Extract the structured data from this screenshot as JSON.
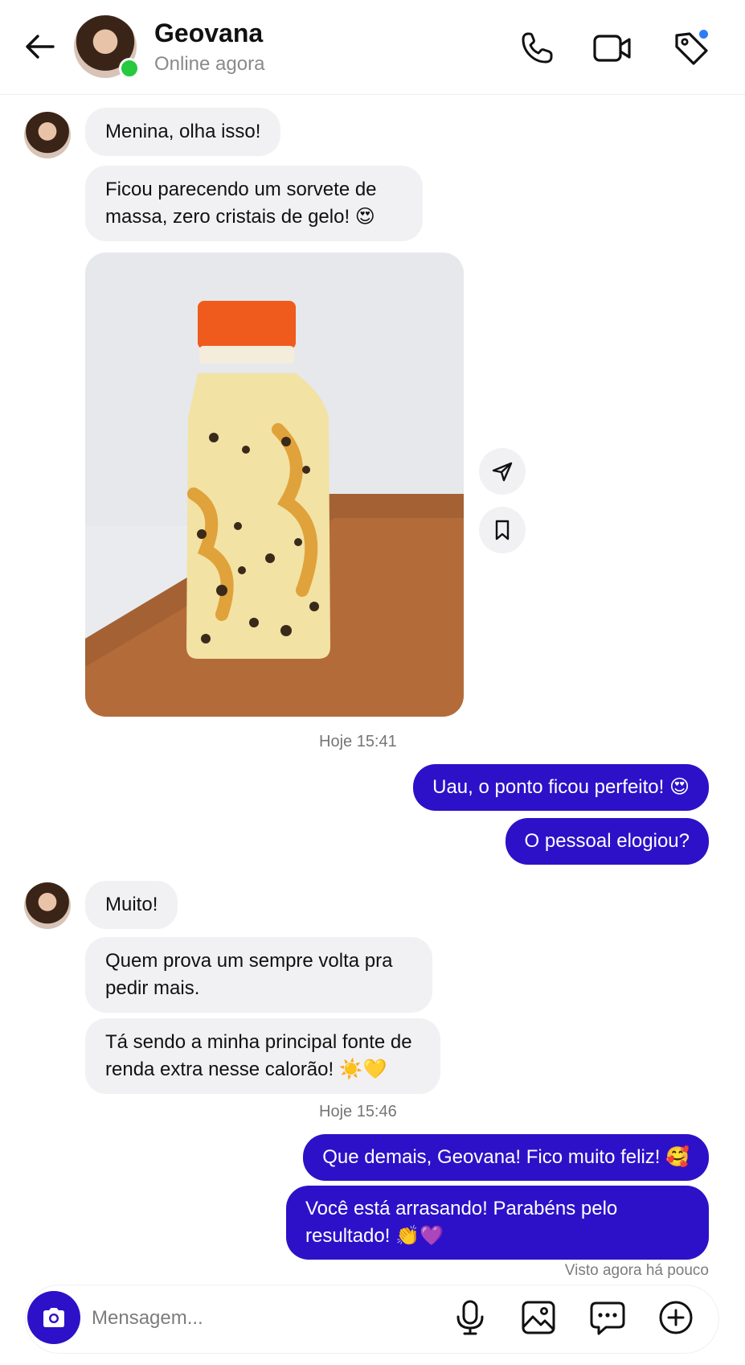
{
  "header": {
    "contact_name": "Geovana",
    "status": "Online agora",
    "icons": [
      "back-arrow-icon",
      "phone-icon",
      "video-camera-icon",
      "tag-icon"
    ]
  },
  "messages": {
    "m1": "Menina, olha isso!",
    "m2": "Ficou parecendo um sorvete de massa, zero cristais de gelo! 😍",
    "timestamp1": "Hoje 15:41",
    "out1": "Uau, o ponto ficou perfeito! 😍",
    "out2": "O pessoal elogiou?",
    "m3": "Muito!",
    "m4": "Quem prova um sempre volta pra pedir mais.",
    "m5": "Tá sendo a minha principal fonte de renda extra nesse calorão! ☀️💛",
    "timestamp2": "Hoje 15:46",
    "out3": "Que demais, Geovana! Fico muito feliz! 🥰",
    "out4": "Você está arrasando! Parabéns pelo resultado! 👏💜",
    "seen": "Visto agora há pouco"
  },
  "composer": {
    "placeholder": "Mensagem...",
    "icons": [
      "camera-icon",
      "microphone-icon",
      "image-icon",
      "sticker-chat-icon",
      "plus-circle-icon"
    ]
  },
  "colors": {
    "outgoing_bubble": "#2d11c8",
    "incoming_bubble": "#f1f1f3",
    "online": "#27c93f",
    "notification_dot": "#2e7cf6"
  }
}
